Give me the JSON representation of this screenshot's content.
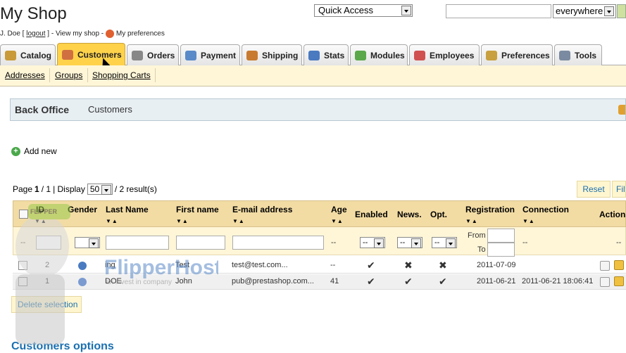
{
  "header": {
    "shop_title": "My Shop",
    "user_name": "J. Doe",
    "logout": "logout",
    "view_shop": "View my shop",
    "preferences": "My preferences",
    "quick_access": "Quick Access",
    "search_value": "",
    "search_scope": "everywhere"
  },
  "tabs": [
    {
      "label": "Catalog",
      "color": "#c89a3a"
    },
    {
      "label": "Customers",
      "color": "#d07040",
      "active": true
    },
    {
      "label": "Orders",
      "color": "#888888"
    },
    {
      "label": "Payment",
      "color": "#5a8ac8"
    },
    {
      "label": "Shipping",
      "color": "#c87a30"
    },
    {
      "label": "Stats",
      "color": "#4a7ac0"
    },
    {
      "label": "Modules",
      "color": "#5aa84a"
    },
    {
      "label": "Employees",
      "color": "#d05050"
    },
    {
      "label": "Preferences",
      "color": "#c8a040"
    },
    {
      "label": "Tools",
      "color": "#7a8aa0"
    }
  ],
  "subnav": [
    "Addresses",
    "Groups",
    "Shopping Carts"
  ],
  "breadcrumb": {
    "root": "Back Office",
    "current": "Customers"
  },
  "add_new": "Add new",
  "pager": {
    "page_label": "Page",
    "page": "1",
    "total_pages": "/ 1",
    "display_label": "| Display",
    "per_page": "50",
    "results": "/ 2 result(s)"
  },
  "buttons": {
    "reset": "Reset",
    "filter": "Filter",
    "delete_selection": "Delete selection"
  },
  "table": {
    "headers": [
      "ID",
      "Gender",
      "Last Name",
      "First name",
      "E-mail address",
      "Age",
      "Enabled",
      "News.",
      "Opt.",
      "Registration",
      "Connection",
      "Actions"
    ],
    "filter": {
      "dash": "--",
      "from": "From",
      "to": "To"
    },
    "rows": [
      {
        "id": "2",
        "last": "ing",
        "first": "Test",
        "email": "test@test.com...",
        "age": "--",
        "enabled": "yes",
        "news": "no",
        "opt": "no",
        "registration": "2011-07-09",
        "connection": ""
      },
      {
        "id": "1",
        "last": "DOE",
        "first": "John",
        "email": "pub@prestashop.com...",
        "age": "41",
        "enabled": "yes",
        "news": "yes",
        "opt": "yes",
        "registration": "2011-06-21",
        "connection": "2011-06-21 18:06:41"
      }
    ]
  },
  "options_title": "Customers options",
  "watermark": {
    "brand": "FlipperHost",
    "tagline": "an invest in company",
    "badge": "FLIPPER"
  }
}
